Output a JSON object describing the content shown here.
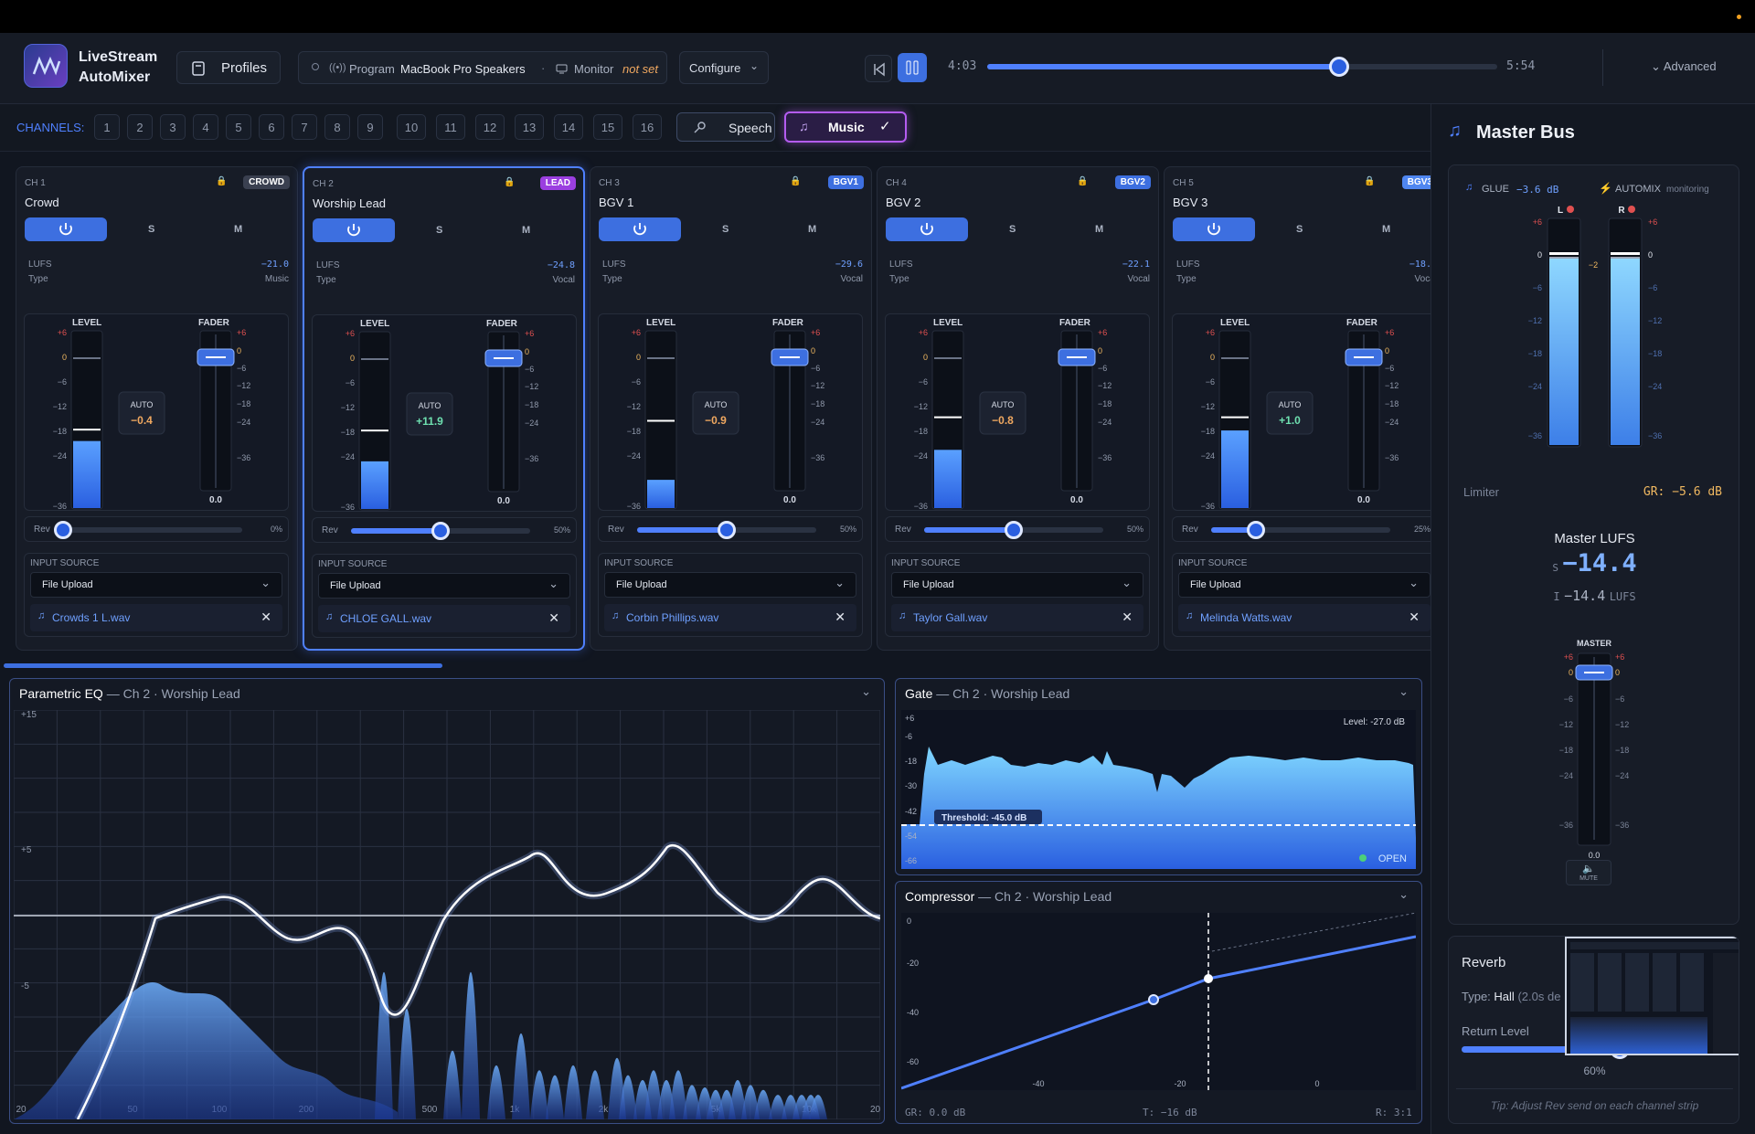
{
  "app": {
    "name_line1": "LiveStream",
    "name_line2": "AutoMixer",
    "profiles_label": "Profiles"
  },
  "output": {
    "program_label": "Program",
    "program_device": "MacBook Pro Speakers",
    "monitor_label": "Monitor",
    "monitor_value": "not set",
    "configure_label": "Configure"
  },
  "transport": {
    "elapsed": "4:03",
    "total": "5:54",
    "progress": 0.69,
    "advanced_label": "Advanced"
  },
  "channels_bar": {
    "label": "CHANNELS:",
    "numbers": [
      "1",
      "2",
      "3",
      "4",
      "5",
      "6",
      "7",
      "8",
      "9",
      "10",
      "11",
      "12",
      "13",
      "14",
      "15",
      "16"
    ],
    "speech_label": "Speech",
    "music_label": "Music"
  },
  "strips": [
    {
      "ch": "CH 1",
      "name": "Crowd",
      "tag": "CROWD",
      "tag_color": "#3a4050",
      "lufs": "−21.0",
      "type": "Music",
      "auto": "−0.4",
      "auto_color": "#f0a860",
      "level_fill": 0.38,
      "peak": 0.45,
      "fader": "0.0",
      "rev_pct": "0%",
      "rev": 0.0,
      "source": "File Upload",
      "file": "Crowds 1 L.wav",
      "selected": false
    },
    {
      "ch": "CH 2",
      "name": "Worship Lead",
      "tag": "LEAD",
      "tag_color": "#9b3fe0",
      "lufs": "−24.8",
      "type": "Vocal",
      "auto": "+11.9",
      "auto_color": "#6ee0b0",
      "level_fill": 0.27,
      "peak": 0.45,
      "fader": "0.0",
      "rev_pct": "50%",
      "rev": 0.5,
      "source": "File Upload",
      "file": "CHLOE GALL.wav",
      "selected": true
    },
    {
      "ch": "CH 3",
      "name": "BGV 1",
      "tag": "BGV1",
      "tag_color": "#3d6fe0",
      "lufs": "−29.6",
      "type": "Vocal",
      "auto": "−0.9",
      "auto_color": "#f0a860",
      "level_fill": 0.16,
      "peak": 0.5,
      "fader": "0.0",
      "rev_pct": "50%",
      "rev": 0.5,
      "source": "File Upload",
      "file": "Corbin Phillips.wav",
      "selected": false
    },
    {
      "ch": "CH 4",
      "name": "BGV 2",
      "tag": "BGV2",
      "tag_color": "#3d6fe0",
      "lufs": "−22.1",
      "type": "Vocal",
      "auto": "−0.8",
      "auto_color": "#f0a860",
      "level_fill": 0.33,
      "peak": 0.52,
      "fader": "0.0",
      "rev_pct": "50%",
      "rev": 0.5,
      "source": "File Upload",
      "file": "Taylor Gall.wav",
      "selected": false
    },
    {
      "ch": "CH 5",
      "name": "BGV 3",
      "tag": "BGV3",
      "tag_color": "#4f86f0",
      "lufs": "−18.0",
      "type": "Vocal",
      "auto": "+1.0",
      "auto_color": "#6ee0b0",
      "level_fill": 0.44,
      "peak": 0.52,
      "fader": "0.0",
      "rev_pct": "25%",
      "rev": 0.25,
      "source": "File Upload",
      "file": "Melinda Watts.wav",
      "selected": false
    }
  ],
  "strip_labels": {
    "lufs": "LUFS",
    "type": "Type",
    "level": "LEVEL",
    "fader": "FADER",
    "auto": "AUTO",
    "rev": "Rev",
    "input_source": "INPUT SOURCE",
    "s": "S",
    "m": "M"
  },
  "meter_scale": [
    "+6",
    "0",
    "−6",
    "−12",
    "−18",
    "−24",
    "−36"
  ],
  "eq": {
    "title": "Parametric EQ",
    "subtitle": "— Ch 2 · Worship Lead",
    "y_labels": [
      "+15",
      "+5",
      "-5"
    ],
    "x_labels": [
      "20",
      "50",
      "100",
      "200",
      "500",
      "1k",
      "2k",
      "5k",
      "10k",
      "20k"
    ]
  },
  "gate": {
    "title": "Gate",
    "subtitle": "— Ch 2 · Worship Lead",
    "level": "Level: -27.0 dB",
    "threshold": "Threshold: -45.0 dB",
    "state": "OPEN",
    "y_labels": [
      "+6",
      "-6",
      "-18",
      "-30",
      "-42",
      "-54",
      "-66"
    ]
  },
  "compressor": {
    "title": "Compressor",
    "subtitle": "— Ch 2 · Worship Lead",
    "y_labels": [
      "0",
      "-20",
      "-40",
      "-60"
    ],
    "x_labels": [
      "-40",
      "-20",
      "0"
    ],
    "gr": "GR: 0.0 dB",
    "threshold": "T: −16 dB",
    "ratio": "R: 3:1"
  },
  "master": {
    "title": "Master Bus",
    "glue_label": "GLUE",
    "glue_value": "−3.6 dB",
    "automix_label": "AUTOMIX",
    "automix_state": "monitoring",
    "left_label": "L",
    "right_label": "R",
    "left_value": "−1.3",
    "right_value": "−1.3",
    "peak_hold": "−2",
    "scale": [
      "+6",
      "0",
      "−6",
      "−12",
      "−18",
      "−24",
      "−36"
    ],
    "limiter_label": "Limiter",
    "limiter_gr": "GR: −5.6 dB",
    "lufs_title": "Master LUFS",
    "lufs_s_prefix": "S",
    "lufs_s": "−14.4",
    "lufs_i_prefix": "I",
    "lufs_i": "−14.4",
    "lufs_unit": "LUFS",
    "fader_label": "MASTER",
    "fader_value": "0.0",
    "mute_label": "MUTE",
    "fader_scale": [
      "+6",
      "0",
      "−6",
      "−12",
      "−18",
      "−24",
      "−36"
    ]
  },
  "reverb": {
    "title": "Reverb",
    "type_label": "Type:",
    "type_value": "Hall",
    "type_detail": "(2.0s de",
    "return_label": "Return Level",
    "return_pct": "60%",
    "return": 0.6,
    "tip": "Tip: Adjust Rev send on each channel strip"
  },
  "colors": {
    "accent": "#3d6fe0",
    "lead": "#9b3fe0",
    "background": "#111620",
    "warning": "#f0a860",
    "good": "#6ee0b0",
    "meter_red": "#e05050"
  }
}
